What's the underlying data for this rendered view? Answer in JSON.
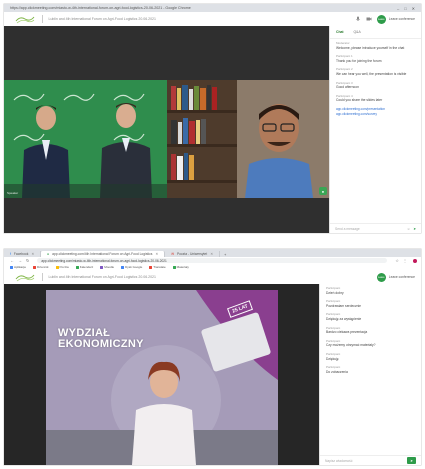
{
  "screen1": {
    "window_title": "https://app.clickmeeting.com/miasto-w-4th-international-forum-on-agri-food-logistics-20-06-2021 - Google Chrome",
    "meeting_title": "Lublin and 4th International Forum on Agri-Food Logistics 20.06.2021",
    "leave_label": "Leave",
    "leave_text": "Leave conference",
    "sidebar_tabs": [
      "Chat",
      "Q&A"
    ],
    "chat_messages": [
      {
        "who": "Moderator",
        "text": "Welcome, please introduce yourself in the chat"
      },
      {
        "who": "Participant 1",
        "text": "Thank you for joining the forum"
      },
      {
        "who": "Participant 2",
        "text": "We can hear you well, the presentation is visible"
      },
      {
        "who": "Participant 3",
        "text": "Good afternoon"
      },
      {
        "who": "Participant 4",
        "text": "Could you share the slides later"
      }
    ],
    "chat_links": [
      "app.clickmeeting.com/presentation",
      "app.clickmeeting.com/survey"
    ],
    "composer_placeholder": "Send a message",
    "tile_label": "Speaker"
  },
  "screen2": {
    "tabs": [
      {
        "label": "Facebook",
        "active": false
      },
      {
        "label": "app.clickmeeting.com/4th International Forum on Agri-Food Logistics",
        "active": true
      },
      {
        "label": "Poczta - Uniwersytet",
        "active": false
      }
    ],
    "url": "app.clickmeeting.com/miasto-w-4th-international-forum-on-agri-food-logistics-20-06-2021",
    "bookmarks": [
      "Aplikacje",
      "Dziennik",
      "Poczta",
      "Kalendarz",
      "Moodle",
      "Dysk Google",
      "Translate",
      "Materiały"
    ],
    "bookmark_colors": [
      "#4285f4",
      "#ea4335",
      "#fbbc05",
      "#34a853",
      "#7e57c2",
      "#4285f4",
      "#ea4335",
      "#34a853"
    ],
    "banner_text": "WYDZIAŁ EKONOMICZNY",
    "banner_badge": "25 LAT",
    "chat_messages": [
      {
        "who": "Participant",
        "text": "Dzień dobry"
      },
      {
        "who": "Participant",
        "text": "Pozdrawiam serdecznie"
      },
      {
        "who": "Participant",
        "text": "Dziękuję za wystąpienie"
      },
      {
        "who": "Participant",
        "text": "Bardzo ciekawa prezentacja"
      },
      {
        "who": "Participant",
        "text": "Czy możemy otrzymać materiały?"
      },
      {
        "who": "Participant",
        "text": "Dziękuję"
      },
      {
        "who": "Participant",
        "text": "Do zobaczenia"
      }
    ],
    "composer_placeholder": "Napisz wiadomość"
  },
  "colors": {
    "accent_green": "#2e9c4a",
    "stage_dark": "#2f2f2f",
    "link_blue": "#2f6fd1"
  }
}
